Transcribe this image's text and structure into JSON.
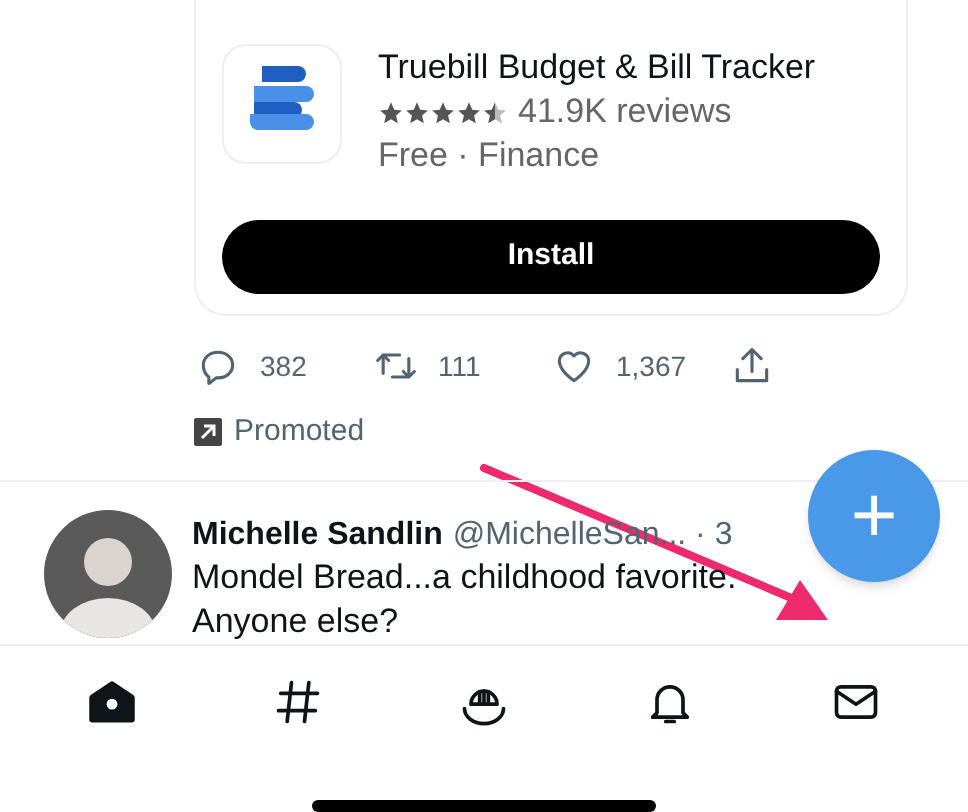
{
  "ad_card": {
    "app_name": "Truebill Budget & Bill Tracker",
    "stars": 4.5,
    "reviews": "41.9K reviews",
    "meta": "Free · Finance",
    "button": "Install"
  },
  "actions": [
    {
      "kind": "reply",
      "count": "382"
    },
    {
      "kind": "retweet",
      "count": "111"
    },
    {
      "kind": "like",
      "count": "1,367"
    },
    {
      "kind": "share"
    }
  ],
  "promoted": "Promoted",
  "tweet": {
    "name": "Michelle Sandlin",
    "handle": "@MichelleSan... · 3",
    "text": "Mondel Bread...a childhood favorite. Anyone else?"
  },
  "compose_button": "+",
  "nav": [
    {
      "kind": "home",
      "selected": true
    },
    {
      "kind": "explore",
      "selected": false
    },
    {
      "kind": "spaces",
      "selected": false
    },
    {
      "kind": "notifications",
      "selected": false
    },
    {
      "kind": "messages",
      "selected": false
    }
  ]
}
